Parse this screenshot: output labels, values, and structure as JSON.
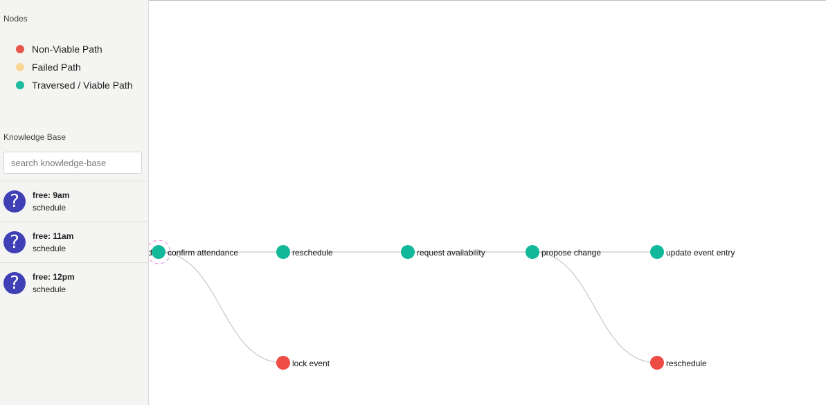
{
  "sidebar": {
    "nodes_title": "Nodes",
    "legend": [
      {
        "label": "Non-Viable Path",
        "color": "#e8574b"
      },
      {
        "label": "Failed Path",
        "color": "#f8d697"
      },
      {
        "label": "Traversed / Viable Path",
        "color": "#1abc9c"
      }
    ],
    "kb_title": "Knowledge Base",
    "search_placeholder": "search knowledge-base",
    "search_value": "",
    "kb_items": [
      {
        "icon": "question-icon",
        "title": "free: 9am",
        "subtitle": "schedule"
      },
      {
        "icon": "question-icon",
        "title": "free: 11am",
        "subtitle": "schedule"
      },
      {
        "icon": "question-icon",
        "title": "free: 12pm",
        "subtitle": "schedule"
      }
    ]
  },
  "graph": {
    "colors": {
      "viable": "#12b89a",
      "non_viable": "#ee4c44",
      "edge": "#bdbdbd",
      "selected_ring": "#f0a8e8"
    },
    "nodes": [
      {
        "label": "confirm attendance",
        "status": "viable",
        "selected": true
      },
      {
        "label": "reschedule",
        "status": "viable"
      },
      {
        "label": "request availability",
        "status": "viable"
      },
      {
        "label": "propose change",
        "status": "viable"
      },
      {
        "label": "update event entry",
        "status": "viable"
      },
      {
        "label": "lock event",
        "status": "non_viable"
      },
      {
        "label": "reschedule",
        "status": "non_viable"
      }
    ],
    "edges": [
      [
        0,
        1
      ],
      [
        1,
        2
      ],
      [
        2,
        3
      ],
      [
        3,
        4
      ],
      [
        0,
        5
      ],
      [
        3,
        6
      ]
    ]
  }
}
